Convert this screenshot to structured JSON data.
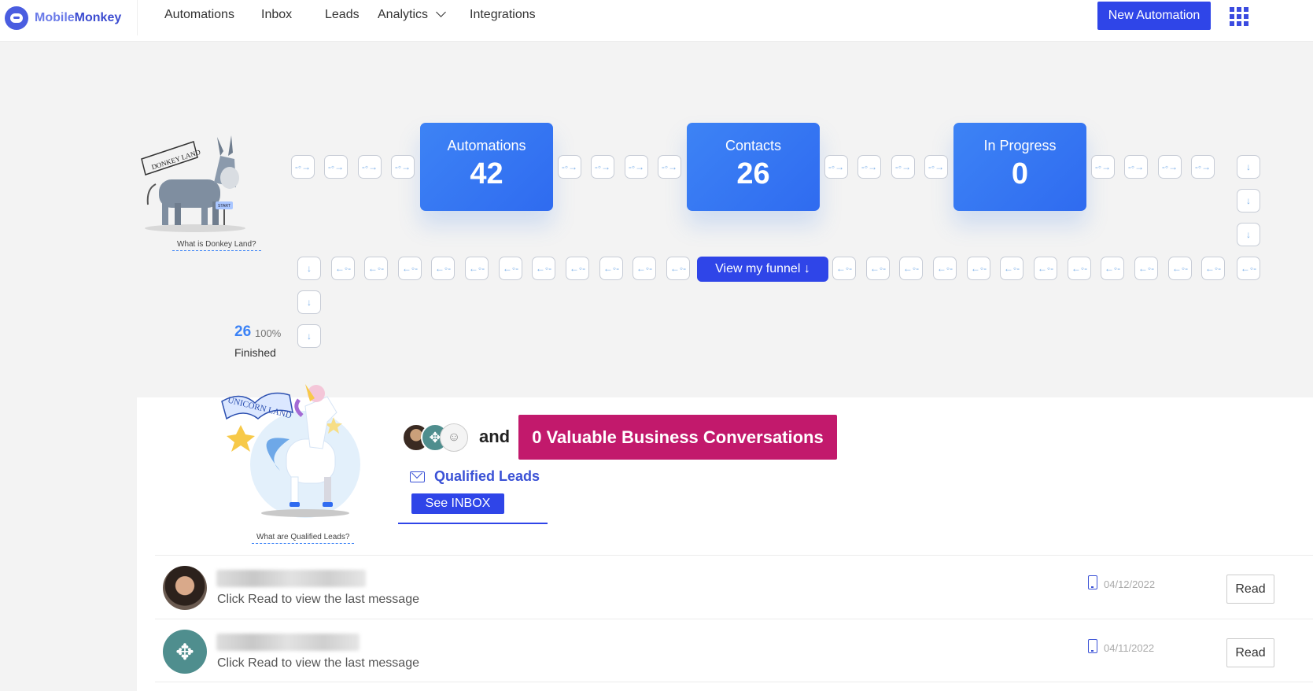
{
  "brand": {
    "name_part1": "Mobile",
    "name_part2": "Monkey"
  },
  "nav": {
    "automations": "Automations",
    "inbox": "Inbox",
    "leads": "Leads",
    "analytics": "Analytics",
    "integrations": "Integrations",
    "new_automation": "New Automation"
  },
  "funnel": {
    "donkey_link": "What is Donkey Land?",
    "donkey_sign": "DONKEY LAND",
    "donkey_start": "START",
    "stats": [
      {
        "label": "Automations",
        "value": "42"
      },
      {
        "label": "Contacts",
        "value": "26"
      },
      {
        "label": "In Progress",
        "value": "0"
      }
    ],
    "view_funnel": "View my funnel ↓",
    "finished_count": "26",
    "finished_pct": "100%",
    "finished_label": "Finished"
  },
  "leads_panel": {
    "unicorn_link": "What are Qualified Leads?",
    "unicorn_sign": "UNICORN LAND",
    "and_text": "and",
    "conversations": "0 Valuable Business Conversations",
    "qualified_leads": "Qualified Leads",
    "see_inbox": "See INBOX"
  },
  "messages": [
    {
      "text": "Click Read to view the last message",
      "date": "04/12/2022",
      "read": "Read"
    },
    {
      "text": "Click Read to view the last message",
      "date": "04/11/2022",
      "read": "Read"
    }
  ],
  "colors": {
    "primary": "#2f45e8",
    "card": "#3d83f5",
    "magenta": "#c2196c",
    "link": "#3b82f6"
  }
}
